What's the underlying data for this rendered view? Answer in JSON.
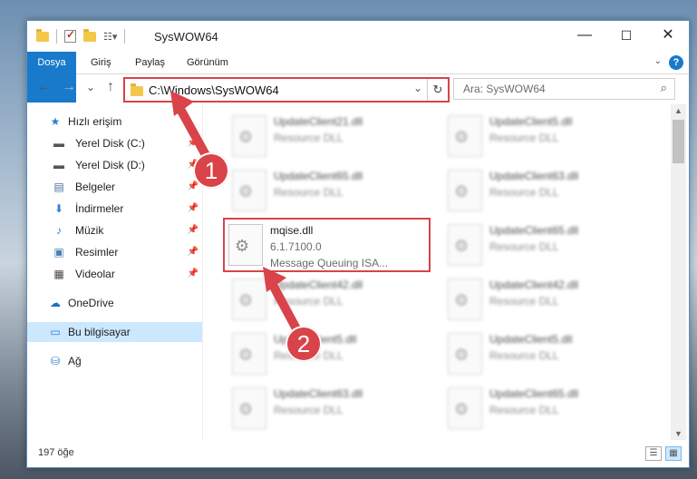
{
  "window": {
    "title": "SysWOW64",
    "controls": {
      "minimize": "—",
      "maximize": "☐",
      "close": "✕"
    }
  },
  "ribbon": {
    "tabs": [
      "Dosya",
      "Giriş",
      "Paylaş",
      "Görünüm"
    ],
    "help": "?",
    "collapse": "⌄"
  },
  "nav": {
    "back": "←",
    "forward": "→",
    "recent": "⌄",
    "up": "↑",
    "address": "C:\\Windows\\SysWOW64",
    "dropdown": "⌄",
    "refresh": "↻",
    "search_placeholder": "Ara: SysWOW64",
    "search_icon": "⌕"
  },
  "sidebar": {
    "items": [
      {
        "label": "Hızlı erişim",
        "icon": "star-icon",
        "glyph": "★",
        "pinned": false
      },
      {
        "label": "Yerel Disk (C:)",
        "icon": "drive-icon",
        "glyph": "▬",
        "pinned": true
      },
      {
        "label": "Yerel Disk (D:)",
        "icon": "drive-icon",
        "glyph": "▬",
        "pinned": true
      },
      {
        "label": "Belgeler",
        "icon": "documents-icon",
        "glyph": "▤",
        "pinned": true
      },
      {
        "label": "İndirmeler",
        "icon": "download-icon",
        "glyph": "⬇",
        "pinned": true
      },
      {
        "label": "Müzik",
        "icon": "music-icon",
        "glyph": "♪",
        "pinned": true
      },
      {
        "label": "Resimler",
        "icon": "pictures-icon",
        "glyph": "▣",
        "pinned": true
      },
      {
        "label": "Videolar",
        "icon": "video-icon",
        "glyph": "▦",
        "pinned": true
      },
      {
        "label": "OneDrive",
        "icon": "cloud-icon",
        "glyph": "☁",
        "pinned": false
      },
      {
        "label": "Bu bilgisayar",
        "icon": "computer-icon",
        "glyph": "▭",
        "pinned": false
      },
      {
        "label": "Ağ",
        "icon": "network-icon",
        "glyph": "⛁",
        "pinned": false
      }
    ],
    "pin_glyph": "📌"
  },
  "files": {
    "left": [
      {
        "name": "UpdateClient21.dll",
        "desc": "Resource DLL"
      },
      {
        "name": "UpdateClient65.dll",
        "desc": "Resource DLL"
      },
      {
        "name": "mqise.dll",
        "desc": "6.1.7100.0",
        "desc2": "Message Queuing ISA..."
      },
      {
        "name": "UpdateClient42.dll",
        "desc": "Resource DLL"
      },
      {
        "name": "UpdateClient5.dll",
        "desc": "Resource DLL"
      },
      {
        "name": "UpdateClient63.dll",
        "desc": "Resource DLL"
      }
    ],
    "right": [
      {
        "name": "UpdateClient5.dll",
        "desc": "Resource DLL"
      },
      {
        "name": "UpdateClient63.dll",
        "desc": "Resource DLL"
      },
      {
        "name": "UpdateClient65.dll",
        "desc": "Resource DLL"
      },
      {
        "name": "UpdateClient42.dll",
        "desc": "Resource DLL"
      },
      {
        "name": "UpdateClient5.dll",
        "desc": "Resource DLL"
      },
      {
        "name": "UpdateClient65.dll",
        "desc": "Resource DLL"
      }
    ]
  },
  "status": {
    "count": "197 öğe"
  },
  "annotations": {
    "one": "1",
    "two": "2",
    "color": "#d9434a"
  }
}
